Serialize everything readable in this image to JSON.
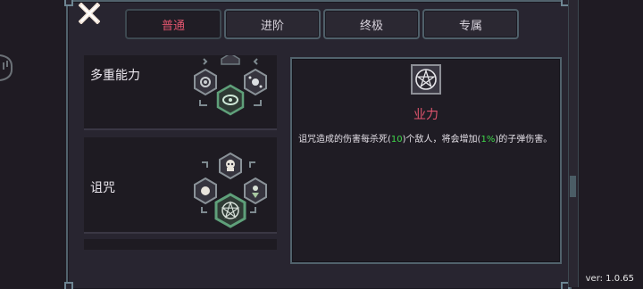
{
  "tabs": [
    {
      "label": "普通",
      "active": true
    },
    {
      "label": "进阶",
      "active": false
    },
    {
      "label": "终极",
      "active": false
    },
    {
      "label": "专属",
      "active": false
    }
  ],
  "list": {
    "items": [
      {
        "label": "多重能力"
      },
      {
        "label": "诅咒"
      }
    ]
  },
  "detail": {
    "icon": "pentagram-icon",
    "title": "业力",
    "desc": {
      "p1": "诅咒造成的伤害每杀死(",
      "v1": "10",
      "p2": ")个敌人，将会增加(",
      "v2": "1%",
      "p3": ")的子弹伤害。"
    }
  },
  "version": "ver: 1.0.65",
  "colors": {
    "accent": "#e0556e",
    "highlight": "#3fd84a",
    "frame": "#51626c",
    "panel": "#1f1c24"
  }
}
